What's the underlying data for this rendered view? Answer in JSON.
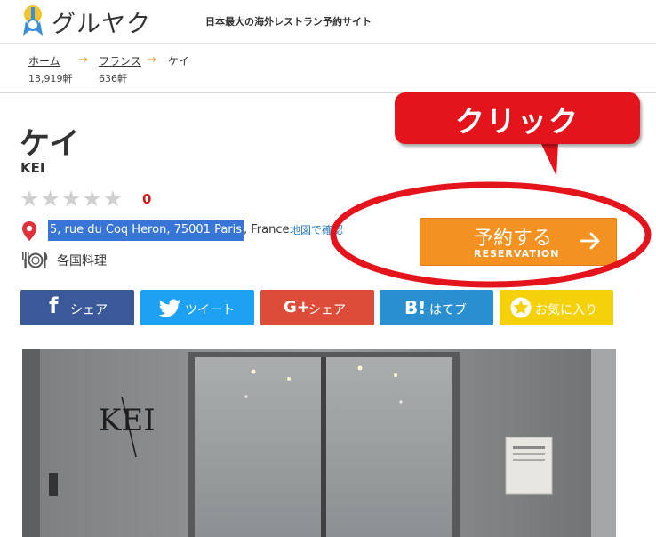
{
  "header": {
    "logo_text": "グルヤク",
    "tagline": "日本最大の海外レストラン予約サイト"
  },
  "breadcrumb": [
    {
      "label": "ホーム",
      "count": "13,919軒"
    },
    {
      "label": "フランス",
      "count": "636軒"
    },
    {
      "label": "ケイ"
    }
  ],
  "breadcrumb_arrow": "→",
  "restaurant": {
    "name": "ケイ",
    "name_en": "KEI",
    "rating_count": "0",
    "address_highlighted": "5, rue du Coq Heron, 75001 Paris",
    "address_rest": ", France",
    "map_link": "地図で確認",
    "cuisine": "各国料理"
  },
  "reserve": {
    "label": "予約する",
    "sub_label": "RESERVATION"
  },
  "share": {
    "facebook": {
      "glyph": "f",
      "label": "シェア"
    },
    "twitter": {
      "label": "ツイート"
    },
    "google": {
      "glyph": "G+",
      "label": "シェア"
    },
    "hatena": {
      "glyph": "B!",
      "label": "はてブ"
    },
    "favorite": {
      "label": "お気に入り"
    }
  },
  "photo": {
    "sign_text": "KEI"
  },
  "annotation": {
    "callout_text": "クリック"
  },
  "colors": {
    "accent_orange": "#f39221",
    "annotation_red": "#e3141c",
    "facebook": "#3b5998",
    "twitter": "#1da1f2",
    "google": "#dd4b39",
    "hatena": "#2a8fd1",
    "favorite": "#f5d10b"
  }
}
